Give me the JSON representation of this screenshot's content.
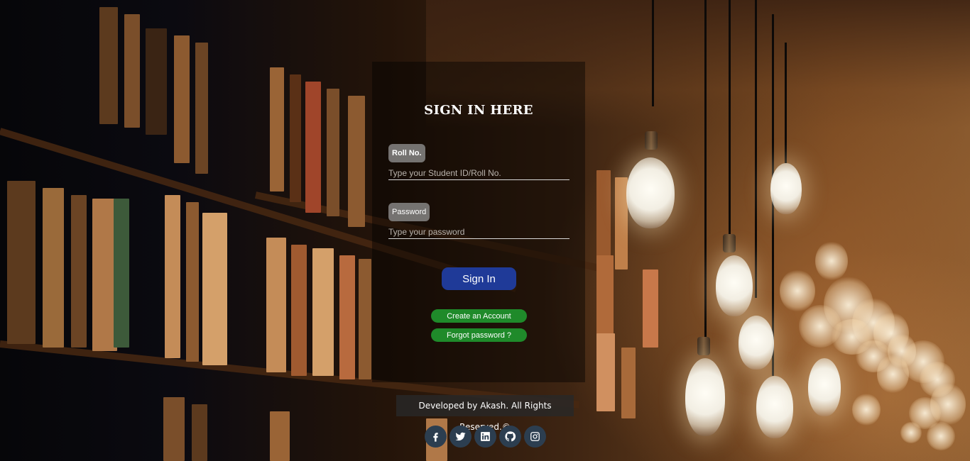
{
  "login": {
    "title": "SIGN IN HERE",
    "roll_label": "Roll No.",
    "roll_placeholder": "Type your Student ID/Roll No.",
    "password_label": "Password",
    "password_placeholder": "Type your password",
    "signin_label": "Sign In",
    "create_account_label": "Create an Account",
    "forgot_password_label": "Forgot password ?"
  },
  "footer": {
    "text": "Developed by Akash. All Rights Reserved.©"
  },
  "social": [
    "facebook-icon",
    "twitter-icon",
    "linkedin-icon",
    "github-icon",
    "instagram-icon"
  ],
  "colors": {
    "signin_button": "#1f3a98",
    "pill_buttons": "#1f8a2a",
    "social_circle": "#2c3e50"
  }
}
